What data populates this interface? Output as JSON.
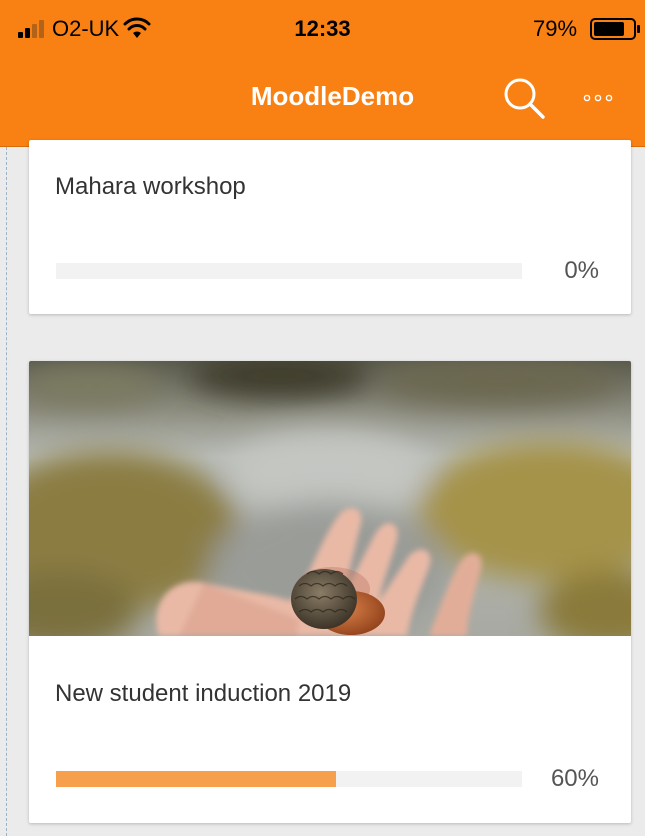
{
  "status_bar": {
    "carrier": "O2-UK",
    "time": "12:33",
    "battery_percent": "79%",
    "battery_level": 0.79,
    "signal_bars": 2
  },
  "app_bar": {
    "title": "MoodleDemo",
    "search_icon": "search-icon",
    "more_icon": "more-options-icon"
  },
  "colors": {
    "header": "#f98012",
    "progress_fill": "#f6a04d",
    "progress_track": "#f2f2f2",
    "page_background": "#ebebeb"
  },
  "courses": [
    {
      "title": "Mahara workshop",
      "progress_label": "0%",
      "progress_value": 0
    },
    {
      "title": "New student induction 2019",
      "progress_label": "60%",
      "progress_value": 0.6,
      "image": "hand-holding-acorn-photo"
    }
  ]
}
